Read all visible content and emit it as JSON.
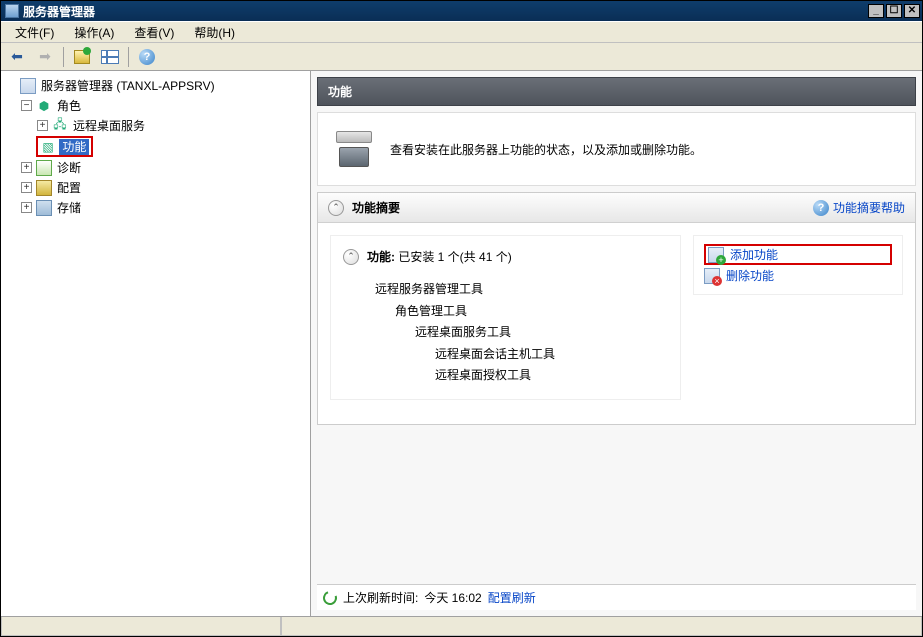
{
  "window": {
    "title": "服务器管理器"
  },
  "menu": {
    "file": "文件(F)",
    "action": "操作(A)",
    "view": "查看(V)",
    "help": "帮助(H)"
  },
  "tree": {
    "root": "服务器管理器 (TANXL-APPSRV)",
    "roles": "角色",
    "rds": "远程桌面服务",
    "features": "功能",
    "diagnostics": "诊断",
    "config": "配置",
    "storage": "存储"
  },
  "content": {
    "header": "功能",
    "intro": "查看安装在此服务器上功能的状态，以及添加或删除功能。"
  },
  "summary": {
    "title": "功能摘要",
    "help": "功能摘要帮助",
    "installed_label": "功能:",
    "installed_text": "已安装 1 个(共 41 个)",
    "installed0": "远程服务器管理工具",
    "installed1": "角色管理工具",
    "installed2": "远程桌面服务工具",
    "installed3a": "远程桌面会话主机工具",
    "installed3b": "远程桌面授权工具"
  },
  "actions": {
    "add": "添加功能",
    "remove": "删除功能"
  },
  "refresh": {
    "label": "上次刷新时间:",
    "time": "今天 16:02",
    "link": "配置刷新"
  }
}
